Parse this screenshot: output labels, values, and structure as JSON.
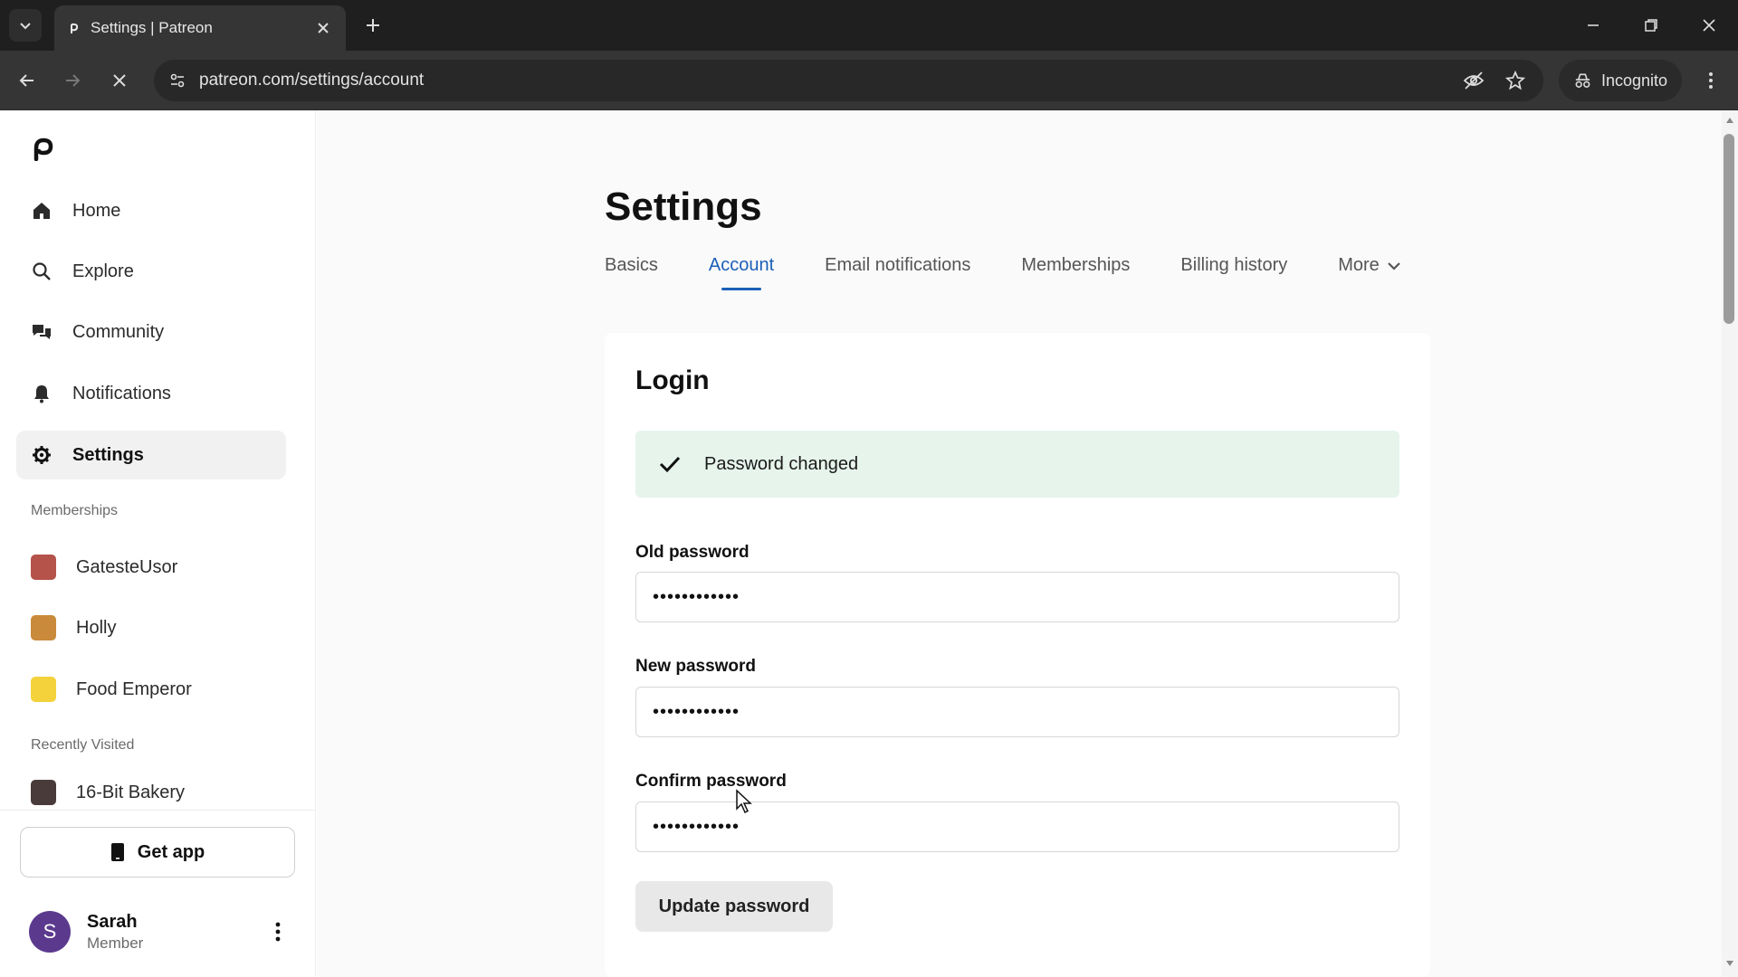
{
  "browser": {
    "tab_title": "Settings | Patreon",
    "url": "patreon.com/settings/account",
    "incognito_label": "Incognito"
  },
  "sidebar": {
    "nav": [
      {
        "label": "Home",
        "icon": "home-icon"
      },
      {
        "label": "Explore",
        "icon": "search-icon"
      },
      {
        "label": "Community",
        "icon": "chat-bubbles-icon"
      },
      {
        "label": "Notifications",
        "icon": "bell-icon"
      },
      {
        "label": "Settings",
        "icon": "gear-icon"
      }
    ],
    "memberships_label": "Memberships",
    "memberships": [
      {
        "label": "GatesteUsor",
        "color": "#b5524a"
      },
      {
        "label": "Holly",
        "color": "#c98a3b"
      },
      {
        "label": "Food Emperor",
        "color": "#f3d23c"
      }
    ],
    "recent_label": "Recently Visited",
    "recent": [
      {
        "label": "16-Bit Bakery",
        "color": "#4a3b3b"
      }
    ],
    "get_app_label": "Get app",
    "user": {
      "initial": "S",
      "name": "Sarah",
      "role": "Member"
    }
  },
  "main": {
    "title": "Settings",
    "tabs": [
      {
        "label": "Basics"
      },
      {
        "label": "Account"
      },
      {
        "label": "Email notifications"
      },
      {
        "label": "Memberships"
      },
      {
        "label": "Billing history"
      },
      {
        "label": "More"
      }
    ],
    "login": {
      "title": "Login",
      "alert": "Password changed",
      "old_label": "Old password",
      "old_value": "••••••••••••",
      "new_label": "New password",
      "new_value": "••••••••••••",
      "confirm_label": "Confirm password",
      "confirm_value": "••••••••••••",
      "button": "Update password"
    }
  },
  "colors": {
    "accent": "#1b5fb8",
    "success_bg": "#e6f4ec",
    "avatar": "#5b3a8e"
  }
}
